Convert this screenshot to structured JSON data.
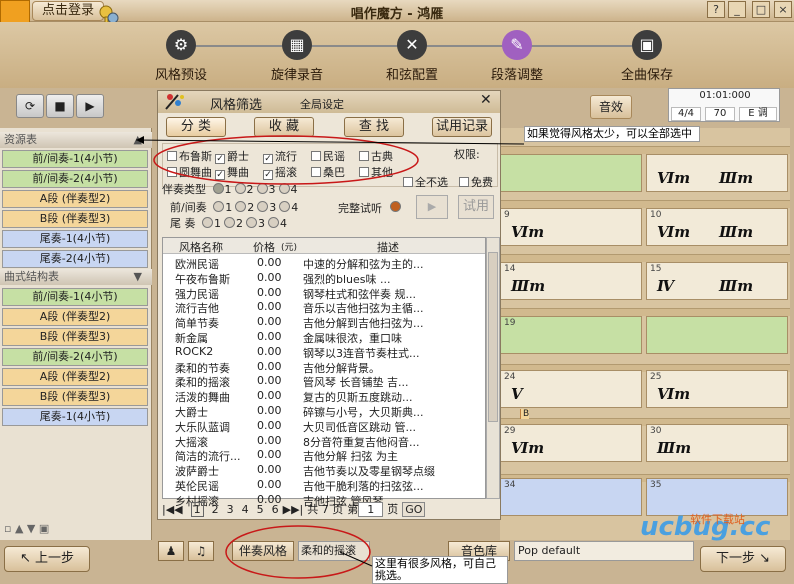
{
  "app": {
    "title": "唱作魔方 - 鸿雁",
    "login": "点击登录",
    "win_buttons": [
      "?",
      "_",
      "□",
      "×"
    ]
  },
  "toolbar": {
    "items": [
      {
        "label": "风格预设",
        "icon": "gear-icon"
      },
      {
        "label": "旋律录音",
        "icon": "film-icon"
      },
      {
        "label": "和弦配置",
        "icon": "tools-icon"
      },
      {
        "label": "段落调整",
        "icon": "pencil-icon"
      },
      {
        "label": "全曲保存",
        "icon": "save-icon"
      }
    ]
  },
  "transport": {
    "effect": "音效",
    "time": "01:01:000",
    "meter": "4/4",
    "tempo": "70",
    "key": "E 调"
  },
  "left": {
    "resources_title": "资源表",
    "resources": [
      {
        "label": "前/间奏-1(4小节)",
        "c": "g"
      },
      {
        "label": "前/间奏-2(4小节)",
        "c": "g"
      },
      {
        "label": "A段 (伴奏型2)",
        "c": "y"
      },
      {
        "label": "B段 (伴奏型3)",
        "c": "y"
      },
      {
        "label": "尾奏-1(4小节)",
        "c": "b"
      },
      {
        "label": "尾奏-2(4小节)",
        "c": "b"
      }
    ],
    "structure_title": "曲式结构表",
    "structure": [
      {
        "label": "前/间奏-1(4小节)",
        "c": "g"
      },
      {
        "label": "A段 (伴奏型2)",
        "c": "y"
      },
      {
        "label": "B段 (伴奏型3)",
        "c": "y"
      },
      {
        "label": "前/间奏-2(4小节)",
        "c": "g"
      },
      {
        "label": "A段 (伴奏型2)",
        "c": "y"
      },
      {
        "label": "B段 (伴奏型3)",
        "c": "y"
      },
      {
        "label": "尾奏-1(4小节)",
        "c": "b"
      }
    ],
    "prev": "上一步"
  },
  "dialog": {
    "title": "风格筛选",
    "subtitle": "全局设定",
    "tabs": [
      "分 类",
      "收 藏",
      "查 找",
      "试用记录"
    ],
    "checks": [
      {
        "label": "布鲁斯",
        "on": false
      },
      {
        "label": "爵士",
        "on": true
      },
      {
        "label": "流行",
        "on": true
      },
      {
        "label": "民谣",
        "on": false
      },
      {
        "label": "古典",
        "on": false
      },
      {
        "label": "圆舞曲",
        "on": false
      },
      {
        "label": "舞曲",
        "on": true
      },
      {
        "label": "摇滚",
        "on": true
      },
      {
        "label": "桑巴",
        "on": false
      },
      {
        "label": "其他",
        "on": false
      },
      {
        "label": "全不选",
        "on": false
      },
      {
        "label": "免费",
        "on": false
      }
    ],
    "permission": "权限:",
    "acc_type": "伴奏类型",
    "intro": "前/间奏",
    "outro": "尾  奏",
    "nums": [
      "1",
      "2",
      "3",
      "4"
    ],
    "full_preview": "完整试听",
    "trial": "试用",
    "cols": {
      "name": "风格名称",
      "price": "价格",
      "unit": "(元)",
      "desc": "描述"
    },
    "rows": [
      [
        "欧洲民谣",
        "0.00",
        "中速的分解和弦为主的..."
      ],
      [
        "午夜布鲁斯",
        "0.00",
        "强烈的blues味 ..."
      ],
      [
        "强力民谣",
        "0.00",
        "钢琴柱式和弦伴奏 规..."
      ],
      [
        "流行吉他",
        "0.00",
        "音乐以吉他扫弦为主循..."
      ],
      [
        "简单节奏",
        "0.00",
        "吉他分解到吉他扫弦为..."
      ],
      [
        "新金属",
        "0.00",
        "金属味很浓，重口味"
      ],
      [
        "ROCK2",
        "0.00",
        "钢琴以3连音节奏柱式..."
      ],
      [
        "柔和的节奏",
        "0.00",
        "吉他分解背景。"
      ],
      [
        "柔和的摇滚",
        "0.00",
        "管风琴 长音铺垫 吉..."
      ],
      [
        "活泼的舞曲",
        "0.00",
        "复古的贝斯五度跳动..."
      ],
      [
        "大爵士",
        "0.00",
        "碎镲与小号，大贝斯典..."
      ],
      [
        "大乐队蓝调",
        "0.00",
        "大贝司低音区跳动 管..."
      ],
      [
        "大摇滚",
        "0.00",
        "8分音符重复吉他闷音..."
      ],
      [
        "简洁的流行...",
        "0.00",
        "吉他分解 扫弦 为主"
      ],
      [
        "波萨爵士",
        "0.00",
        "吉他节奏以及零星钢琴点缀"
      ],
      [
        "英伦民谣",
        "0.00",
        "吉他干脆利落的扫弦弦..."
      ],
      [
        "乡村摇滚",
        "0.00",
        "吉他扫弦 管风琴 ..."
      ]
    ],
    "pager": {
      "pages": [
        "1",
        "2",
        "3",
        "4",
        "5",
        "6"
      ],
      "total": "共 7 页",
      "page_label": "第",
      "page": "1",
      "page_suffix": "页",
      "go": "GO"
    }
  },
  "grid": {
    "cells": [
      {
        "n": "",
        "c1": "",
        "c2": "",
        "bg": "#c6e0a4"
      },
      {
        "n": "",
        "c1": "Ⅵm",
        "c2": "Ⅲm",
        "bg": "#f2ead8"
      },
      {
        "n": "9",
        "c1": "Ⅵm",
        "c2": "",
        "bg": "#f2ead8"
      },
      {
        "n": "10",
        "c1": "Ⅵm",
        "c2": "Ⅲm",
        "bg": "#f2ead8"
      },
      {
        "n": "14",
        "c1": "Ⅲm",
        "c2": "",
        "bg": "#f2ead8"
      },
      {
        "n": "15",
        "c1": "Ⅳ",
        "c2": "Ⅲm",
        "bg": "#f2ead8"
      },
      {
        "n": "19",
        "c1": "",
        "c2": "",
        "bg": "#c6e0a4"
      },
      {
        "n": "",
        "c1": "",
        "c2": "",
        "bg": "#c6e0a4"
      },
      {
        "n": "24",
        "c1": "Ⅴ",
        "c2": "",
        "bg": "#f2ead8"
      },
      {
        "n": "25",
        "c1": "Ⅵm",
        "c2": "",
        "bg": "#f2ead8"
      },
      {
        "n": "29",
        "c1": "Ⅵm",
        "c2": "",
        "bg": "#f2ead8"
      },
      {
        "n": "30",
        "c1": "Ⅲm",
        "c2": "",
        "bg": "#f2ead8"
      },
      {
        "n": "34",
        "c1": "",
        "c2": "",
        "bg": "#c8d6f2"
      },
      {
        "n": "35",
        "c1": "",
        "c2": "",
        "bg": "#c8d6f2"
      }
    ],
    "b_marker": "B"
  },
  "bottom": {
    "acc_style": "伴奏风格",
    "current_style": "柔和的摇滚",
    "timbre": "音色库",
    "preset": "Pop default",
    "next": "下一步"
  },
  "notes": {
    "top": "如果觉得风格太少，可以全部选中",
    "bottom": "这里有很多风格，可自己挑选。"
  },
  "watermark": {
    "text": "ucbug.cc",
    "small": "软件下载站"
  },
  "colors": {
    "accent": "#f0a020",
    "annotation": "#c81818"
  }
}
